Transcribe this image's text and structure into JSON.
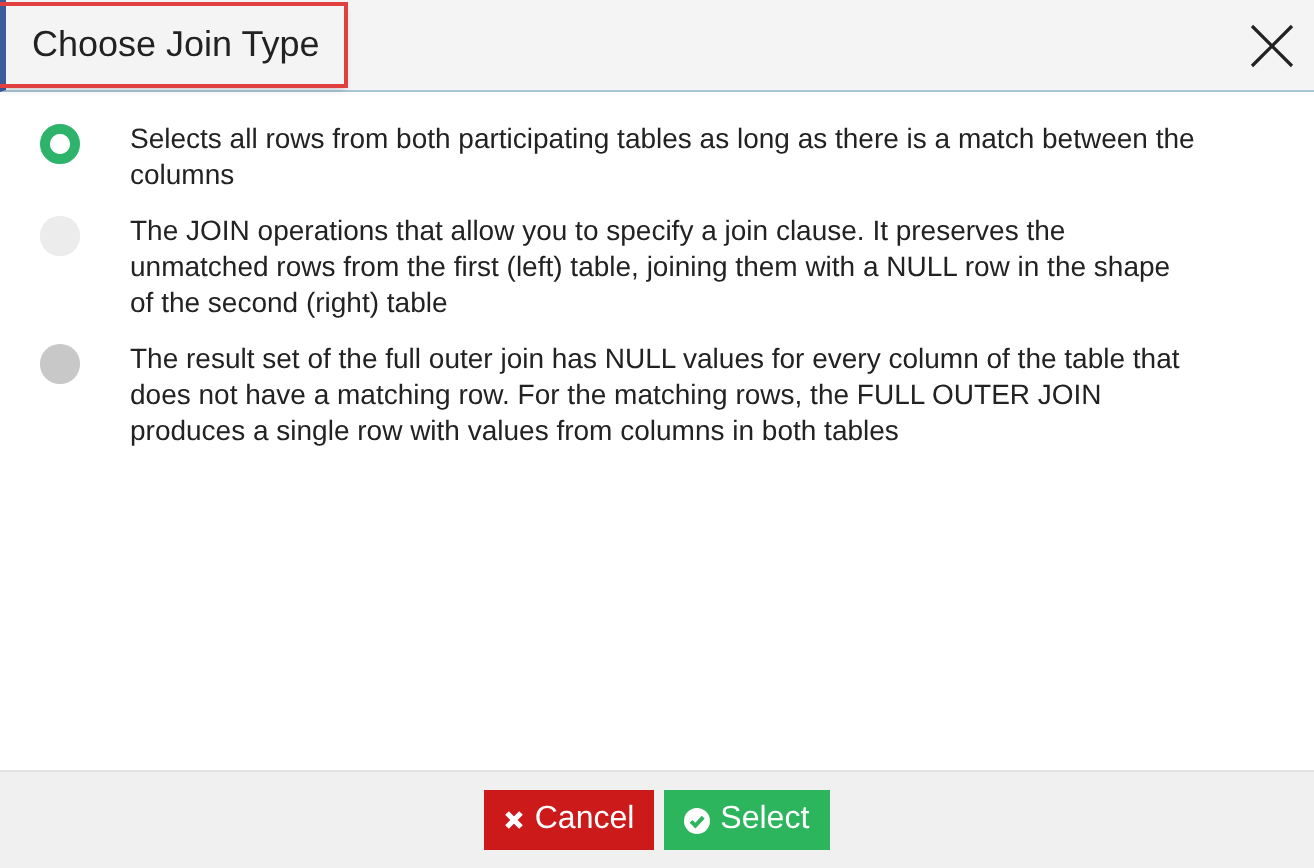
{
  "window": {
    "title": "Choose Join Type",
    "title_highlighted": true
  },
  "options": [
    {
      "text": "Selects all rows from both participating tables as long as there is a match between the columns",
      "selected": true,
      "hovered": false
    },
    {
      "text": "The JOIN operations that allow you to specify a join clause. It preserves the unmatched rows from the first (left) table, joining them with a NULL row in the shape of the second (right) table",
      "selected": false,
      "hovered": false
    },
    {
      "text": "The result set of the full outer join has NULL values for every column of the table that does not have a matching row. For the matching rows, the FULL OUTER JOIN produces a single row with values from columns in both tables",
      "selected": false,
      "hovered": true
    }
  ],
  "buttons": [
    {
      "kind": "cancel",
      "label": "Cancel"
    },
    {
      "kind": "confirm",
      "label": "Select"
    }
  ]
}
